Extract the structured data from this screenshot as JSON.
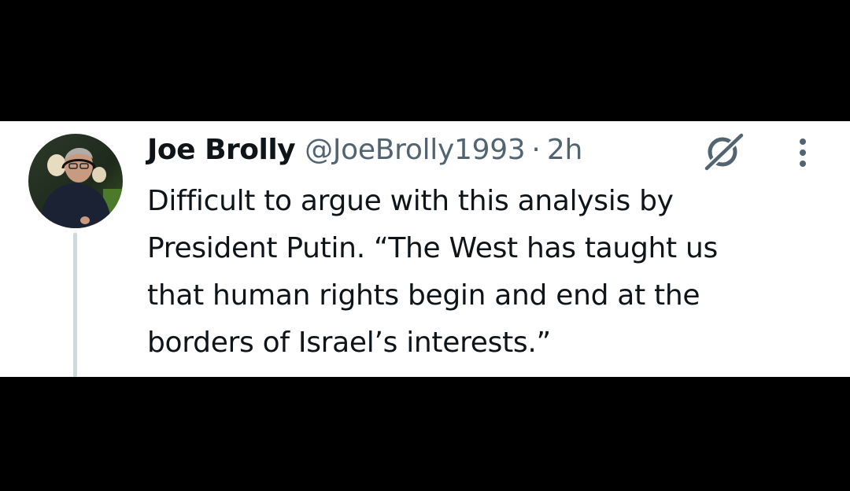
{
  "tweet": {
    "author": {
      "display_name": "Joe Brolly",
      "handle": "@JoeBrolly1993",
      "separator": "·",
      "timestamp": "2h",
      "avatar_icon": "profile-photo"
    },
    "text_lines": [
      "Difficult to argue with this analysis by",
      "President Putin. “The West has taught us",
      "that human rights begin and end at the",
      "borders of Israel’s interests.”"
    ],
    "icons": {
      "badge": "grok-slash-icon",
      "more": "more-vertical-icon"
    },
    "colors": {
      "background": "#ffffff",
      "letterbox": "#000000",
      "primary_text": "#0f1419",
      "secondary_text": "#536471",
      "thread_line": "#cfd9de"
    }
  }
}
